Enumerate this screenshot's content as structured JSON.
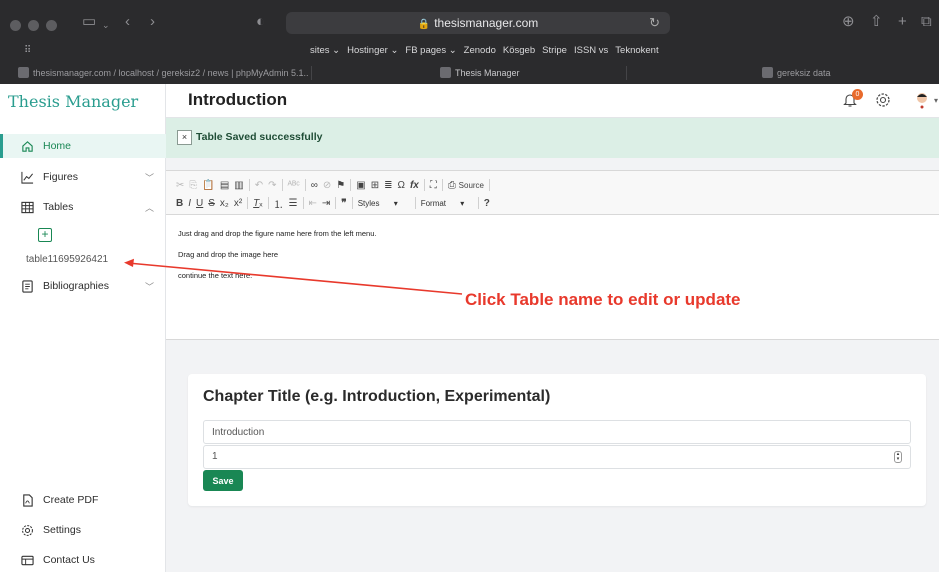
{
  "browser": {
    "url": "thesismanager.com",
    "bookmarks": [
      "sites ⌄",
      "Hostinger ⌄",
      "FB pages ⌄",
      "Zenodo",
      "Kösgeb",
      "Stripe",
      "ISSN vs",
      "Teknokent"
    ],
    "tabs": [
      {
        "label": "thesismanager.com / localhost / gereksiz2 / news | phpMyAdmin 5.1..."
      },
      {
        "label": "Thesis Manager"
      },
      {
        "label": "gereksiz data"
      }
    ]
  },
  "sidebar": {
    "brand": "Thesis Manager",
    "items": [
      {
        "label": "Home",
        "icon": "home-icon"
      },
      {
        "label": "Figures",
        "icon": "line-chart-icon"
      },
      {
        "label": "Tables",
        "icon": "table-icon"
      },
      {
        "label": "Bibliographies",
        "icon": "document-icon"
      }
    ],
    "table_entry": "table11695926421",
    "bottom_items": [
      {
        "label": "Create PDF",
        "icon": "pdf-icon"
      },
      {
        "label": "Settings",
        "icon": "gear-icon"
      },
      {
        "label": "Contact Us",
        "icon": "contact-card-icon"
      }
    ]
  },
  "header": {
    "title": "Introduction",
    "notification_count": "0"
  },
  "alert": {
    "close": "×",
    "message": "Table Saved successfully"
  },
  "editor": {
    "toolbar_row1_text": [
      "Source"
    ],
    "styles_label": "Styles",
    "format_label": "Format",
    "content": [
      "Just drag and drop the figure name here from the left menu.",
      "Drag and drop the image here",
      "continue the text here."
    ]
  },
  "annotation": {
    "callout": "Click Table name to edit or update",
    "color": "#e8392c"
  },
  "chapter": {
    "heading": "Chapter Title (e.g. Introduction, Experimental)",
    "title_value": "Introduction",
    "order_value": "1",
    "save_label": "Save"
  },
  "colors": {
    "brand": "#2a9d8f",
    "success": "#198754",
    "alert_bg": "#dcefe6"
  }
}
